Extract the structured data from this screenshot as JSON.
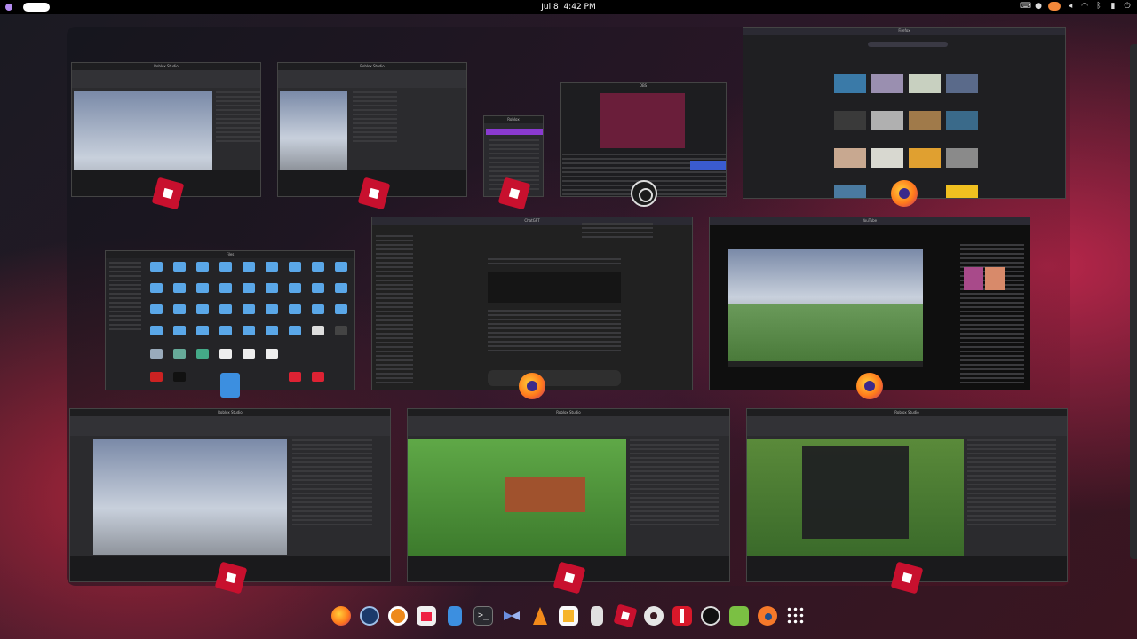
{
  "top_bar": {
    "date": "Jul 8",
    "time": "4:42 PM",
    "tray_icons": [
      "keyboard-icon",
      "bell-icon",
      "firefox-indicator-icon",
      "volume-icon",
      "wifi-icon",
      "bluetooth-icon",
      "battery-icon",
      "power-icon"
    ]
  },
  "overview": {
    "windows": [
      {
        "id": "roblox-studio-1",
        "app": "roblox-studio",
        "title": "Roblox Studio"
      },
      {
        "id": "roblox-studio-2",
        "app": "roblox-studio",
        "title": "Roblox Studio"
      },
      {
        "id": "roblox-launcher",
        "app": "roblox-studio",
        "title": "Roblox"
      },
      {
        "id": "obs",
        "app": "obs",
        "title": "OBS"
      },
      {
        "id": "firefox-feed",
        "app": "firefox",
        "title": "Firefox"
      },
      {
        "id": "file-manager",
        "app": "files",
        "title": "Files"
      },
      {
        "id": "firefox-chat",
        "app": "firefox",
        "title": "ChatGPT"
      },
      {
        "id": "firefox-video",
        "app": "firefox",
        "title": "YouTube"
      },
      {
        "id": "roblox-studio-3",
        "app": "roblox-studio",
        "title": "Roblox Studio"
      },
      {
        "id": "roblox-studio-4",
        "app": "roblox-studio",
        "title": "Roblox Studio"
      },
      {
        "id": "roblox-studio-5",
        "app": "roblox-studio",
        "title": "Roblox Studio"
      }
    ]
  },
  "dock": {
    "apps": [
      {
        "name": "firefox",
        "icon": "firefox-icon"
      },
      {
        "name": "steam",
        "icon": "steam-icon"
      },
      {
        "name": "browser",
        "icon": "orange-circle-icon"
      },
      {
        "name": "software-store",
        "icon": "store-icon"
      },
      {
        "name": "files",
        "icon": "files-icon"
      },
      {
        "name": "terminal",
        "icon": "terminal-icon",
        "glyph": ">_"
      },
      {
        "name": "remote-desktop",
        "icon": "remote-desktop-icon"
      },
      {
        "name": "vlc",
        "icon": "vlc-icon"
      },
      {
        "name": "text-editor",
        "icon": "text-editor-icon"
      },
      {
        "name": "archive-manager",
        "icon": "zip-icon"
      },
      {
        "name": "roblox-studio",
        "icon": "roblox-icon"
      },
      {
        "name": "settings",
        "icon": "gear-icon"
      },
      {
        "name": "red-app",
        "icon": "red-plus-icon"
      },
      {
        "name": "obs",
        "icon": "obs-icon"
      },
      {
        "name": "green-app",
        "icon": "green-block-icon"
      },
      {
        "name": "blender",
        "icon": "blender-icon"
      },
      {
        "name": "app-grid",
        "icon": "app-grid-icon"
      }
    ]
  }
}
